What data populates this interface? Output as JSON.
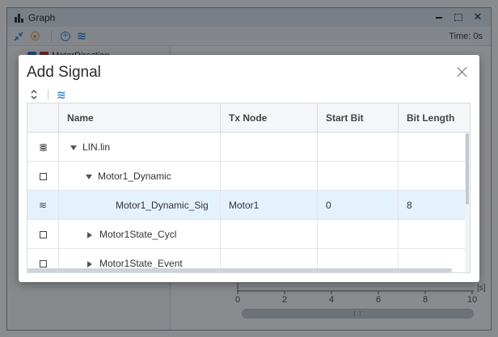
{
  "graph_window": {
    "title": "Graph",
    "time_label": "Time: 0s",
    "signal_name": "MotorDirection",
    "axis": {
      "ticks": [
        "0",
        "2",
        "4",
        "6",
        "8",
        "10"
      ],
      "unit": "[s]"
    }
  },
  "dialog": {
    "title": "Add Signal",
    "columns": [
      "Name",
      "Tx Node",
      "Start Bit",
      "Bit Length"
    ],
    "rows": [
      {
        "icon": "database-icon",
        "name": "LIN.lin",
        "tx_node": "",
        "start_bit": "",
        "bit_length": "",
        "expander": "expanded",
        "selected": false
      },
      {
        "icon": "checkbox-icon",
        "name": "Motor1_Dynamic",
        "tx_node": "",
        "start_bit": "",
        "bit_length": "",
        "expander": "expanded",
        "selected": false
      },
      {
        "icon": "signal-wave-icon",
        "name": "Motor1_Dynamic_Sig",
        "tx_node": "Motor1",
        "start_bit": "0",
        "bit_length": "8",
        "expander": "none",
        "selected": true
      },
      {
        "icon": "checkbox-icon",
        "name": "Motor1State_Cycl",
        "tx_node": "",
        "start_bit": "",
        "bit_length": "",
        "expander": "collapsed",
        "selected": false
      },
      {
        "icon": "checkbox-icon",
        "name": "Motor1State_Event",
        "tx_node": "",
        "start_bit": "",
        "bit_length": "",
        "expander": "collapsed",
        "selected": false
      }
    ]
  },
  "colors": {
    "accent": "#2f86d8",
    "selected_row": "#e4f2fc",
    "signal_color": "#c0262c",
    "record_icon": "#e8a33a"
  }
}
